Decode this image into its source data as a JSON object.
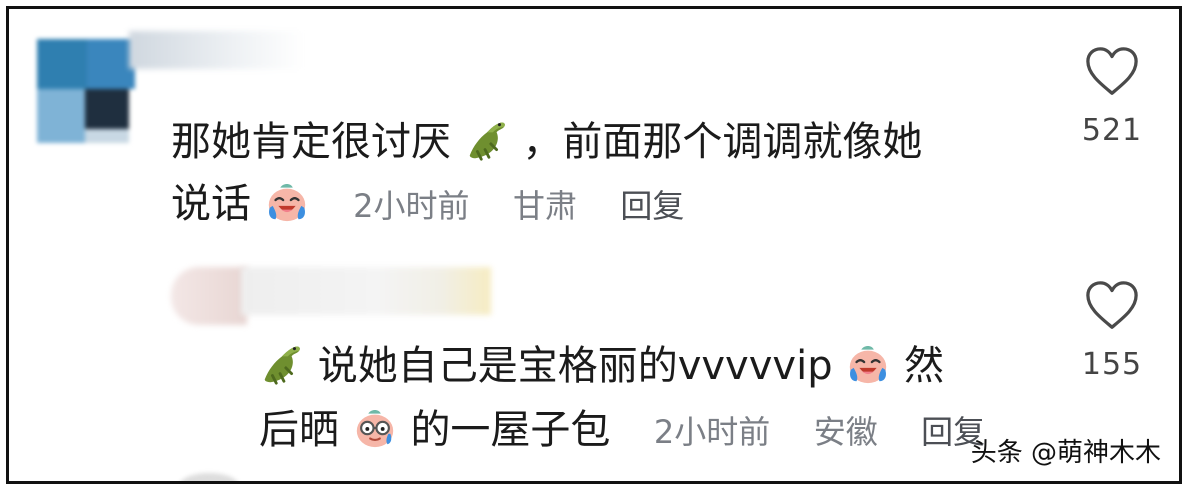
{
  "comments": [
    {
      "text_a": "那她肯定很讨厌",
      "text_b": "，前面那个调调就像她",
      "text_c": "说话",
      "time": "2小时前",
      "location": "甘肃",
      "reply": "回复",
      "likes": "521",
      "icons": [
        "crocodile-emoji",
        "crying-laugh-emoji"
      ]
    },
    {
      "text_a": "说她自己是宝格丽的vvvvvip",
      "text_b": "然",
      "text_c": "后晒",
      "text_d": "的一屋子包",
      "time": "2小时前",
      "location": "安徽",
      "reply": "回复",
      "likes": "155",
      "icons": [
        "crocodile-emoji",
        "crying-laugh-emoji",
        "nerd-glasses-emoji"
      ]
    }
  ],
  "watermark": "头条 @萌神木木",
  "colors": {
    "text": "#1b1b1b",
    "meta": "#7b7f86",
    "border": "#111111"
  }
}
